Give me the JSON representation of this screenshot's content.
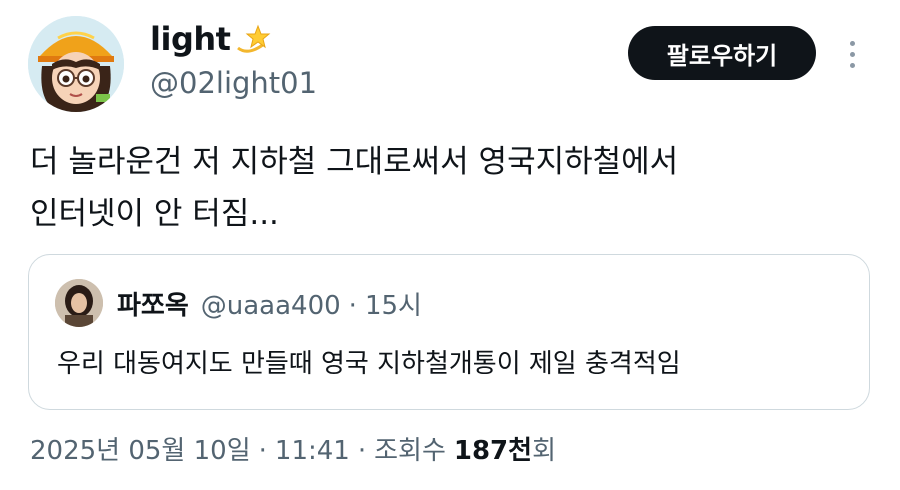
{
  "author": {
    "display_name": "light",
    "handle": "@02light01",
    "badge_icon": "dizzy-star-emoji"
  },
  "actions": {
    "follow_label": "팔로우하기",
    "more_icon": "more-options-icon"
  },
  "tweet": {
    "lines": [
      "더 놀라운건 저 지하철 그대로써서 영국지하철에서",
      "인터넷이 안 터짐..."
    ]
  },
  "quoted_tweet": {
    "display_name": "파쪼옥",
    "handle": "@uaaa400",
    "separator": "·",
    "time": "15시",
    "text": "우리 대동여지도 만들때 영국 지하철개통이 제일 충격적임"
  },
  "meta": {
    "date": "2025년 05월 10일",
    "separator": "·",
    "time": "11:41",
    "views_label": "조회수",
    "views_number": "187천",
    "views_suffix": "회"
  },
  "colors": {
    "text_primary": "#0f1419",
    "text_secondary": "#536471",
    "border": "#cfd9de",
    "button_bg": "#0f1419"
  }
}
